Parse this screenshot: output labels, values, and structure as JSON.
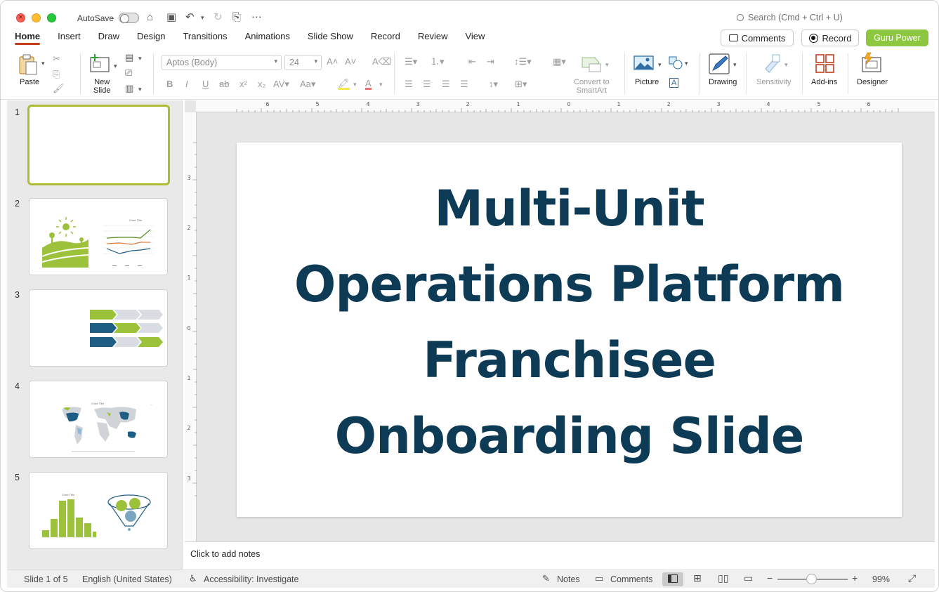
{
  "titlebar": {
    "autosave_label": "AutoSave",
    "search_placeholder": "Search (Cmd + Ctrl + U)"
  },
  "menu": {
    "tabs": [
      "Home",
      "Insert",
      "Draw",
      "Design",
      "Transitions",
      "Animations",
      "Slide Show",
      "Record",
      "Review",
      "View"
    ],
    "active_tab": "Home",
    "comments_label": "Comments",
    "record_label": "Record",
    "guru_label": "Guru Power"
  },
  "ribbon": {
    "paste_label": "Paste",
    "new_slide_label": "New\nSlide",
    "font_name": "Aptos (Body)",
    "font_size": "24",
    "convert_label": "Convert to\nSmartArt",
    "picture_label": "Picture",
    "drawing_label": "Drawing",
    "sensitivity_label": "Sensitivity",
    "addins_label": "Add-ins",
    "designer_label": "Designer"
  },
  "thumbnails": [
    {
      "num": "1"
    },
    {
      "num": "2"
    },
    {
      "num": "3"
    },
    {
      "num": "4"
    },
    {
      "num": "5"
    }
  ],
  "slide": {
    "title_lines": [
      "Multi-Unit",
      "Operations Platform",
      "Franchisee",
      "Onboarding Slide"
    ]
  },
  "notes": {
    "placeholder": "Click to add notes"
  },
  "status": {
    "slide_info": "Slide 1 of 5",
    "language": "English (United States)",
    "accessibility": "Accessibility: Investigate",
    "notes_label": "Notes",
    "comments_label": "Comments",
    "zoom": "99%"
  },
  "colors": {
    "accent": "#c43e1c",
    "guru_green": "#8dc63f",
    "title_navy": "#0d3a55",
    "thumb_select": "#aebc34"
  }
}
